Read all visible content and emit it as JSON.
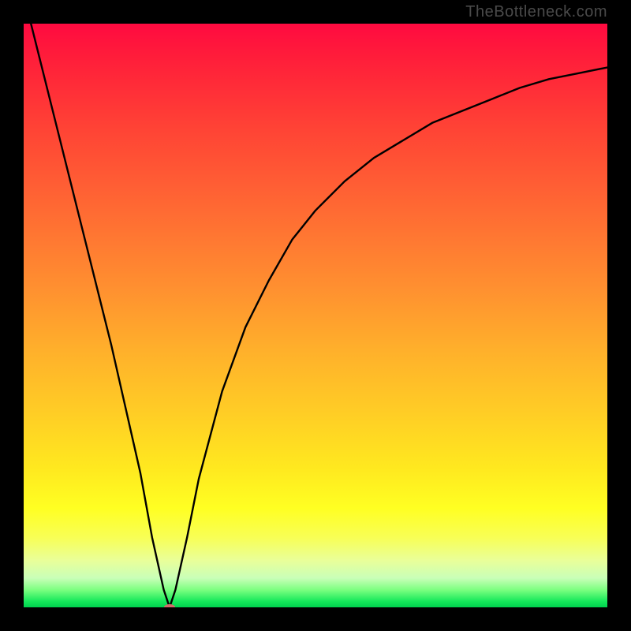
{
  "attribution": "TheBottleneck.com",
  "chart_data": {
    "type": "line",
    "title": "",
    "xlabel": "",
    "ylabel": "",
    "xlim": [
      0,
      100
    ],
    "ylim": [
      0,
      100
    ],
    "grid": false,
    "legend": false,
    "series": [
      {
        "name": "curve",
        "color": "#000000",
        "x": [
          0,
          5,
          10,
          15,
          20,
          22,
          24,
          25,
          26,
          28,
          30,
          34,
          38,
          42,
          46,
          50,
          55,
          60,
          65,
          70,
          75,
          80,
          85,
          90,
          95,
          100
        ],
        "y": [
          105,
          85,
          65,
          45,
          23,
          12,
          3,
          0,
          3,
          12,
          22,
          37,
          48,
          56,
          63,
          68,
          73,
          77,
          80,
          83,
          85,
          87,
          89,
          90.5,
          91.5,
          92.5
        ]
      }
    ],
    "marker": {
      "x": 25,
      "y": 0,
      "color": "#d46a6a",
      "rx": 7,
      "ry": 4
    },
    "background_gradient": {
      "direction": "top-to-bottom",
      "stops": [
        {
          "pos": 0.0,
          "color": "#ff0a40"
        },
        {
          "pos": 0.32,
          "color": "#ff6a33"
        },
        {
          "pos": 0.67,
          "color": "#ffce25"
        },
        {
          "pos": 0.88,
          "color": "#f8ff55"
        },
        {
          "pos": 0.97,
          "color": "#7cff80"
        },
        {
          "pos": 1.0,
          "color": "#00d24f"
        }
      ]
    }
  }
}
